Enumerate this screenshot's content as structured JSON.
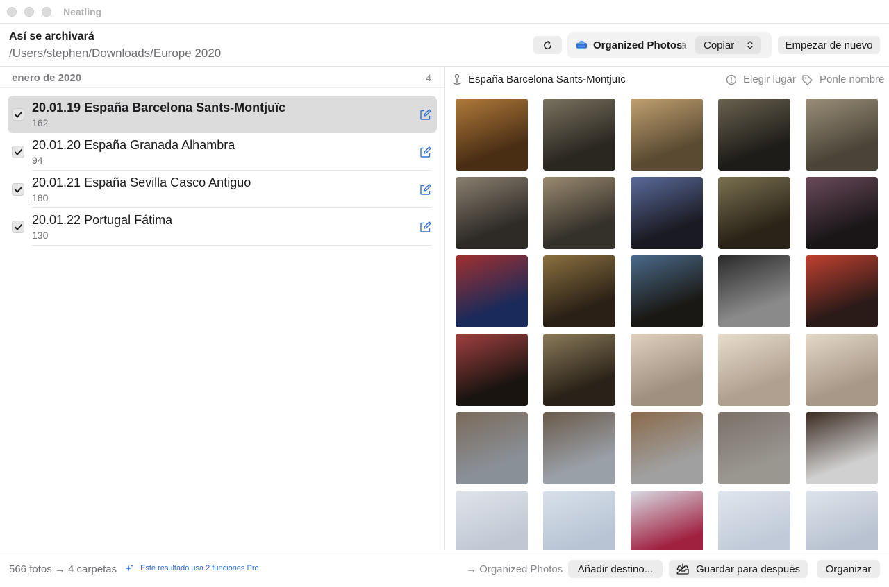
{
  "window": {
    "title": "Neatling"
  },
  "header": {
    "title": "Así se archivará",
    "path": "/Users/stephen/Downloads/Europe 2020",
    "refresh_icon": "refresh-icon",
    "destination": {
      "name": "Organized Photos",
      "connector": "a",
      "mode": "Copiar"
    },
    "restart_label": "Empezar de nuevo"
  },
  "sidebar": {
    "section_title": "enero de 2020",
    "section_count": "4",
    "items": [
      {
        "name": "20.01.19 España Barcelona Sants-Montjuïc",
        "count": "162",
        "checked": true,
        "selected": true
      },
      {
        "name": "20.01.20 España Granada Alhambra",
        "count": "94",
        "checked": true,
        "selected": false
      },
      {
        "name": "20.01.21 España Sevilla Casco Antiguo",
        "count": "180",
        "checked": true,
        "selected": false
      },
      {
        "name": "20.01.22 Portugal Fátima",
        "count": "130",
        "checked": true,
        "selected": false
      }
    ]
  },
  "detail": {
    "folder_title": "España Barcelona Sants-Montjuïc",
    "choose_place_label": "Elegir lugar",
    "name_it_label": "Ponle nombre"
  },
  "footer": {
    "summary": "566 fotos → 4 carpetas",
    "pro_note": "Este resultado usa 2 funciones Pro",
    "destination_note": "→ Organized Photos",
    "add_destination_label": "Añadir destino...",
    "save_later_label": "Guardar para después",
    "organize_label": "Organizar"
  },
  "colors": {
    "accent": "#2f6fd6",
    "selected_row": "#dcdcdc"
  }
}
